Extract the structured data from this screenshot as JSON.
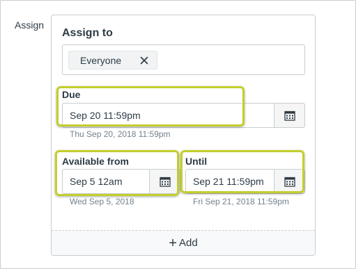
{
  "row_label": "Assign",
  "card": {
    "title": "Assign to",
    "assignees": [
      {
        "label": "Everyone",
        "remove_icon": "close-icon"
      }
    ]
  },
  "due": {
    "label": "Due",
    "value": "Sep 20 11:59pm",
    "hint": "Thu Sep 20, 2018 11:59pm",
    "icon": "calendar-icon"
  },
  "available_from": {
    "label": "Available from",
    "value": "Sep 5 12am",
    "hint": "Wed Sep 5, 2018",
    "icon": "calendar-icon"
  },
  "until": {
    "label": "Until",
    "value": "Sep 21 11:59pm",
    "hint": "Fri Sep 21, 2018 11:59pm",
    "icon": "calendar-icon"
  },
  "add": {
    "plus": "+",
    "label": "Add"
  },
  "colors": {
    "highlight": "#c3cf2a",
    "text": "#2d3b45",
    "hint": "#73818c",
    "border": "#c7cdd1"
  }
}
